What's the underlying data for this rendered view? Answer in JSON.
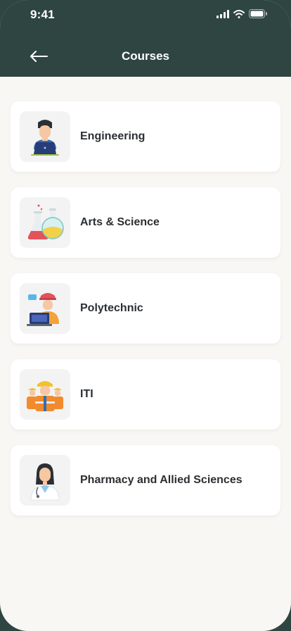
{
  "status_bar": {
    "time": "9:41",
    "icons": [
      "signal-icon",
      "wifi-icon",
      "battery-icon"
    ]
  },
  "header": {
    "title": "Courses",
    "back_icon": "arrow-left-icon",
    "background": "#2e4541"
  },
  "courses": [
    {
      "label": "Engineering",
      "icon": "engineer-laptop-illustration"
    },
    {
      "label": "Arts & Science",
      "icon": "lab-flasks-illustration"
    },
    {
      "label": "Polytechnic",
      "icon": "technician-hardhat-illustration"
    },
    {
      "label": "ITI",
      "icon": "workers-group-illustration"
    },
    {
      "label": "Pharmacy and Allied Sciences",
      "icon": "doctor-illustration"
    }
  ],
  "colors": {
    "page_bg": "#f8f7f3",
    "card_bg": "#ffffff",
    "text": "#2b2f33"
  }
}
